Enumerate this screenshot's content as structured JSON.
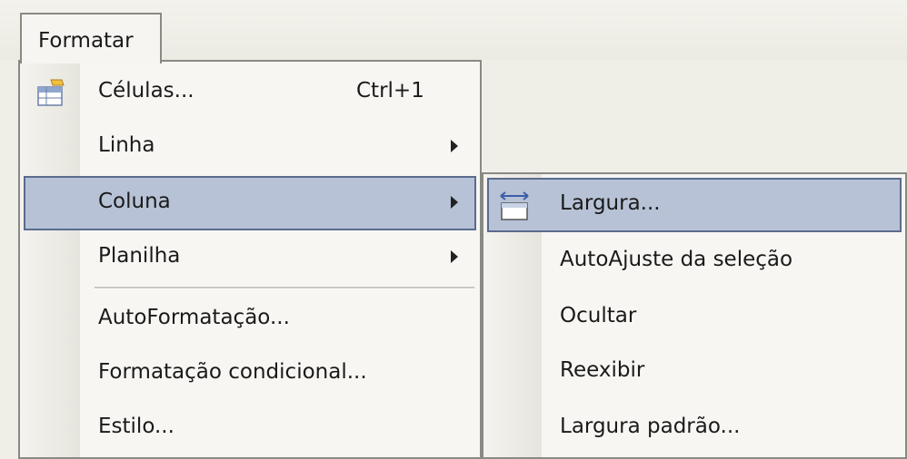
{
  "menubar": {
    "format_menu_label": "Formatar"
  },
  "format_menu": {
    "items": [
      {
        "label": "Células...",
        "shortcut": "Ctrl+1",
        "icon": "cells-icon"
      },
      {
        "label": "Linha",
        "submenu": true
      },
      {
        "label": "Coluna",
        "submenu": true,
        "highlighted": true
      },
      {
        "label": "Planilha",
        "submenu": true
      },
      {
        "label": "AutoFormatação..."
      },
      {
        "label": "Formatação condicional..."
      },
      {
        "label": "Estilo..."
      }
    ]
  },
  "column_submenu": {
    "items": [
      {
        "label": "Largura...",
        "icon": "column-width-icon",
        "highlighted": true
      },
      {
        "label": "AutoAjuste da seleção"
      },
      {
        "label": "Ocultar"
      },
      {
        "label": "Reexibir"
      },
      {
        "label": "Largura padrão..."
      }
    ]
  },
  "colors": {
    "highlight_fill": "#b7c2d6",
    "highlight_border": "#5a6b8e",
    "menu_background": "#f7f6f3"
  }
}
